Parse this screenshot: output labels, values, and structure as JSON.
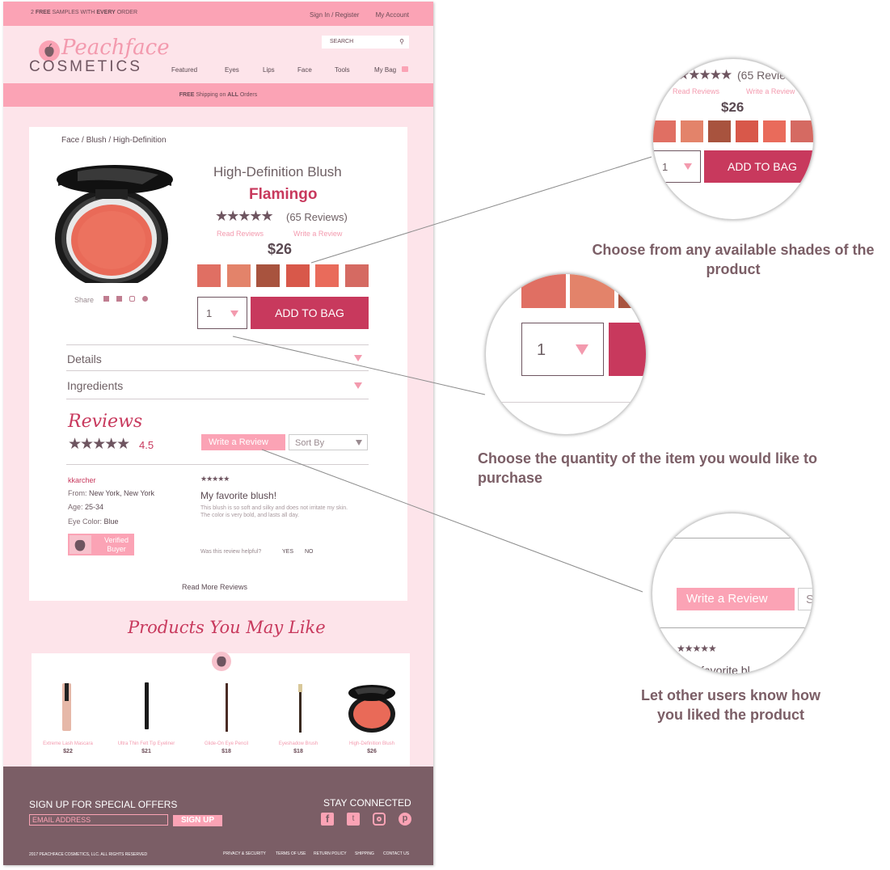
{
  "topbar": {
    "promo_prefix": "2 ",
    "promo_free": "FREE",
    "promo_mid": " SAMPLES WITH ",
    "promo_every": "EVERY",
    "promo_suffix": " ORDER",
    "sign_in": "Sign In / Register",
    "account": "My Account"
  },
  "logo": {
    "line1": "Peachface",
    "line2": "COSMETICS"
  },
  "search": {
    "placeholder": "SEARCH"
  },
  "nav": {
    "items": [
      "Featured",
      "Eyes",
      "Lips",
      "Face",
      "Tools",
      "My Bag"
    ]
  },
  "shipping": {
    "free": "FREE",
    "mid": " Shipping on ",
    "all": "ALL",
    "suffix": " Orders"
  },
  "breadcrumb": "Face / Blush / High-Definition",
  "product": {
    "name": "High-Definition Blush",
    "shade": "Flamingo",
    "rating": 4.5,
    "review_count": "(65 Reviews)",
    "read_reviews": "Read Reviews",
    "write_review": "Write a Review",
    "price": "$26",
    "swatches": [
      "#e06f63",
      "#e3836a",
      "#a8533e",
      "#d8584a",
      "#e96b5b",
      "#d56a62"
    ],
    "quantity": "1",
    "add_to_bag": "ADD TO BAG",
    "share_label": "Share"
  },
  "accordion": {
    "details": "Details",
    "ingredients": "Ingredients"
  },
  "reviews": {
    "heading": "Reviews",
    "avg": "4.5",
    "write_btn": "Write a Review",
    "sort_label": "Sort By",
    "read_more": "Read More Reviews",
    "items": [
      {
        "user": "kkarcher",
        "from_label": "From: ",
        "from": "New York, New York",
        "age_label": "Age: ",
        "age": "25-34",
        "eye_label": "Eye Color: ",
        "eye": "Blue",
        "badge": "Verified Buyer",
        "stars": 4.5,
        "title": "My favorite blush!",
        "body_line1": "This blush is so soft and silky and does not irritate my skin.",
        "body_line2": "The color is very bold, and lasts all day.",
        "helpful_q": "Was this review helpful?",
        "yes": "YES",
        "no": "NO"
      }
    ]
  },
  "recommendations": {
    "heading": "Products You May Like",
    "items": [
      {
        "name": "Extreme Lash Mascara",
        "price": "$22"
      },
      {
        "name": "Ultra Thin Felt Tip Eyeliner",
        "price": "$21"
      },
      {
        "name": "Glide-On Eye Pencil",
        "price": "$18"
      },
      {
        "name": "Eyeshadow Brush",
        "price": "$18"
      },
      {
        "name": "High-Definition Blush",
        "price": "$26"
      }
    ]
  },
  "footer": {
    "signup_heading": "SIGN UP FOR SPECIAL OFFERS",
    "email_placeholder": "EMAIL ADDRESS",
    "signup_btn": "SIGN UP",
    "connect_heading": "STAY CONNECTED",
    "copyright": "2017 PEACHFACE COSMETICS, LLC. ALL RIGHTS RESERVED",
    "links": [
      "PRIVACY & SECURITY",
      "TERMS OF USE",
      "RETURN POLICY",
      "SHIPPING",
      "CONTACT US"
    ]
  },
  "annotations": {
    "shades": "Choose from any available shades of the product",
    "quantity": "Choose the quantity of the item you would like to purchase",
    "review": "Let other users know how you liked the product"
  },
  "zoom1": {
    "review_count": "(65 Revie",
    "read": "Read Reviews",
    "write": "Write a Review",
    "price": "$26",
    "qty": "1",
    "add": "ADD TO BAG"
  },
  "zoom2": {
    "qty": "1"
  },
  "zoom3": {
    "write": "Write a Review",
    "sort_partial": "S",
    "review_partial": "favorite bl"
  },
  "colors": {
    "pink": "#fba3b5",
    "rose": "#c8395d",
    "mauve": "#7b5e66",
    "bg": "#fde4ea"
  }
}
